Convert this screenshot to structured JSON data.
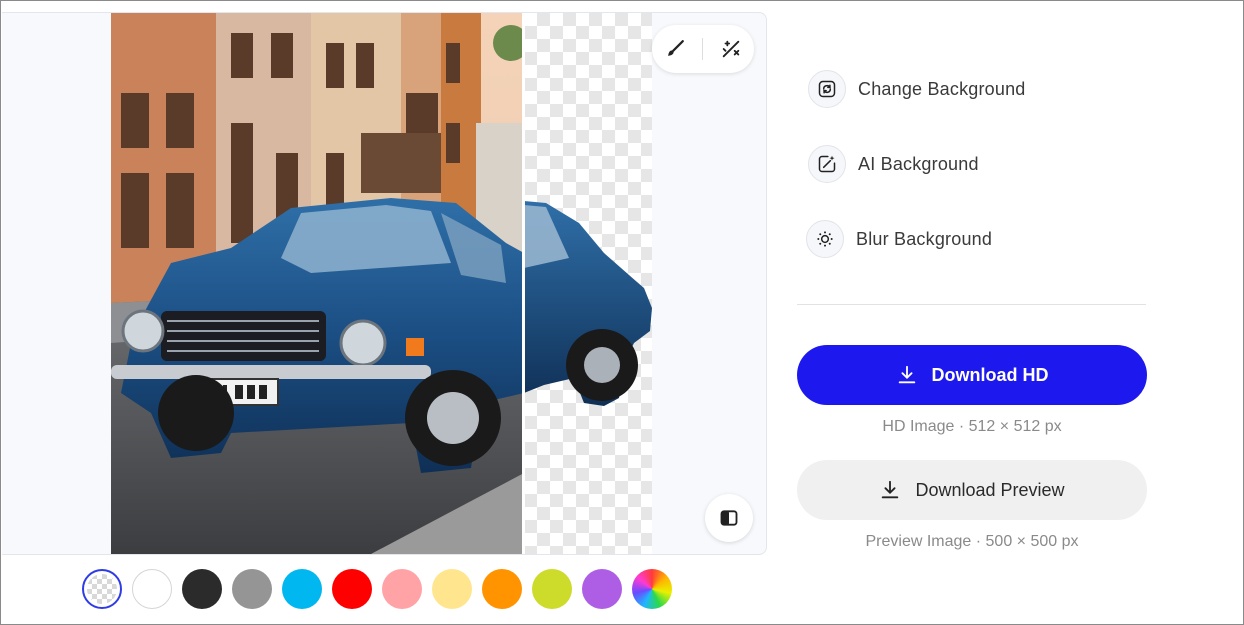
{
  "preview": {
    "tools": {
      "brush": "brush-icon",
      "erase": "magic-erase-icon",
      "compare": "compare-icon"
    }
  },
  "swatches": [
    {
      "name": "transparent",
      "color": "transparent"
    },
    {
      "name": "white",
      "color": "#ffffff"
    },
    {
      "name": "black",
      "color": "#2b2b2b"
    },
    {
      "name": "gray",
      "color": "#959595"
    },
    {
      "name": "sky-blue",
      "color": "#00b7ef"
    },
    {
      "name": "red",
      "color": "#ff0000"
    },
    {
      "name": "pink",
      "color": "#ffa3a6"
    },
    {
      "name": "light-yellow",
      "color": "#ffe68e"
    },
    {
      "name": "orange",
      "color": "#ff9300"
    },
    {
      "name": "lime",
      "color": "#cddb2a"
    },
    {
      "name": "purple",
      "color": "#ae5ee4"
    },
    {
      "name": "rainbow",
      "color": "gradient"
    }
  ],
  "options": {
    "change_bg": "Change Background",
    "ai_bg": "AI Background",
    "blur_bg": "Blur Background"
  },
  "download": {
    "hd_label": "Download HD",
    "hd_meta": "HD Image · 512 × 512 px",
    "preview_label": "Download Preview",
    "preview_meta": "Preview Image · 500 × 500 px"
  },
  "colors": {
    "accent": "#1d18ee",
    "selected_ring": "#2f3ce6"
  }
}
